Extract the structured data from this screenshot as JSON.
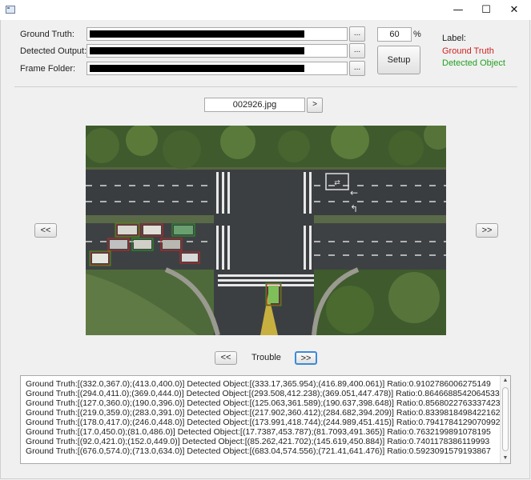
{
  "window": {
    "minimize_glyph": "—",
    "maximize_glyph": "☐",
    "close_glyph": "✕"
  },
  "inputs": {
    "ground_truth_label": "Ground Truth:",
    "detected_output_label": "Detected Output:",
    "frame_folder_label": "Frame Folder:",
    "browse_label": "...",
    "percent_value": "60",
    "percent_sign": "%",
    "setup_label": "Setup"
  },
  "legend": {
    "title": "Label:",
    "ground_truth": "Ground Truth",
    "detected_object": "Detected Object",
    "ground_truth_color": "#cc2222",
    "detected_object_color": "#22a022"
  },
  "navigation": {
    "filename": "002926.jpg",
    "next_file": ">",
    "prev_frame": "<<",
    "next_frame": ">>",
    "prev_trouble": "<<",
    "trouble_label": "Trouble",
    "next_trouble": ">>"
  },
  "log": [
    "Ground Truth:[(332.0,367.0);(413.0,400.0)] Detected Object:[(333.17,365.954);(416.89,400.061)] Ratio:0.9102786006275149",
    "Ground Truth:[(294.0,411.0);(369.0,444.0)] Detected Object:[(293.508,412.238);(369.051,447.478)] Ratio:0.8646688542064533",
    "Ground Truth:[(127.0,360.0);(190.0,396.0)] Detected Object:[(125.063,361.589);(190.637,398.648)] Ratio:0.8568022763337423",
    "Ground Truth:[(219.0,359.0);(283.0,391.0)] Detected Object:[(217.902,360.412);(284.682,394.209)] Ratio:0.8339818498422162",
    "Ground Truth:[(178.0,417.0);(246.0,448.0)] Detected Object:[(173.991,418.744);(244.989,451.415)] Ratio:0.7941784129070992",
    "Ground Truth:[(17.0,450.0);(81.0,486.0)] Detected Object:[(17.7387,453.787);(81.7093,491.365)] Ratio:0.7632199891078195",
    "Ground Truth:[(92.0,421.0);(152.0,449.0)] Detected Object:[(85.262,421.702);(145.619,450.884)] Ratio:0.7401178386119993",
    "Ground Truth:[(676.0,574.0);(713.0,634.0)] Detected Object:[(683.04,574.556);(721.41,641.476)] Ratio:0.5923091579193867"
  ]
}
